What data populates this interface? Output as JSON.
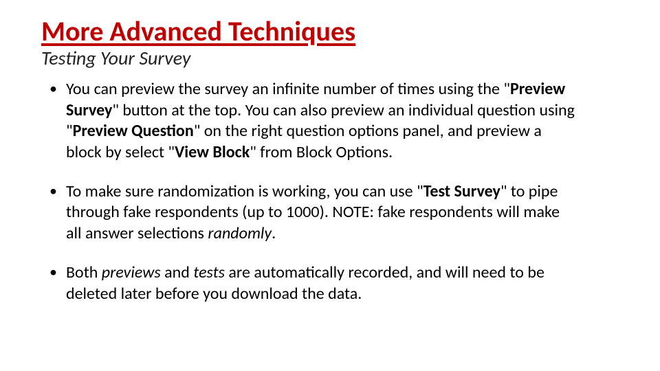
{
  "title": "More Advanced Techniques",
  "subtitle": "Testing Your Survey",
  "bullet1": {
    "p1": "You can preview the survey an infinite number of times using the \"",
    "b1": "Preview Survey",
    "p2": "\" button at the top. You can also preview an individual question using \"",
    "b2": "Preview Question",
    "p3": "\" on the right question options panel, and preview a block by select \"",
    "b3": "View Block",
    "p4": "\" from Block Options."
  },
  "bullet2": {
    "p1": "To make sure randomization is working, you can use \"",
    "b1": "Test Survey",
    "p2": "\" to pipe through fake respondents (up to 1000). NOTE: fake respondents will make all answer selections ",
    "i1": "randomly",
    "p3": "."
  },
  "bullet3": {
    "p1": "Both ",
    "i1": "previews",
    "p2": " and ",
    "i2": "tests",
    "p3": " are automatically recorded, and will need to be deleted later before you download the data."
  }
}
